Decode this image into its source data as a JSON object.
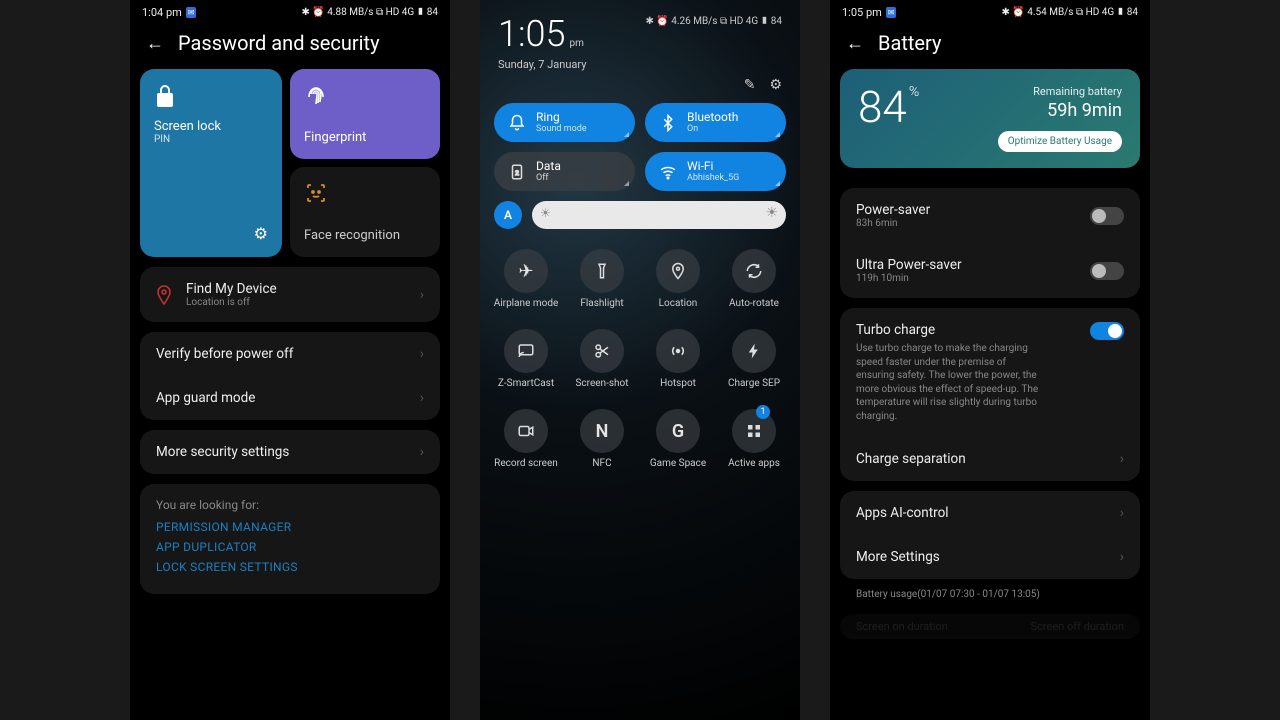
{
  "s1": {
    "status": {
      "time": "1:04 pm",
      "right": "✱ ⏰ 4.88 MB/s ⧉ HD 4G ▮ 84"
    },
    "title": "Password and security",
    "screenlock": {
      "label": "Screen lock",
      "sub": "PIN"
    },
    "fingerprint": "Fingerprint",
    "face": "Face recognition",
    "find": {
      "label": "Find My Device",
      "sub": "Location is off"
    },
    "verify": "Verify before power off",
    "appguard": "App guard mode",
    "more": "More security settings",
    "suggest": {
      "hint": "You are looking for:",
      "a": "PERMISSION MANAGER",
      "b": "APP DUPLICATOR",
      "c": "LOCK SCREEN SETTINGS"
    }
  },
  "s2": {
    "time": "1:05",
    "ampm": "pm",
    "date": "Sunday, 7 January",
    "status_right": "✱ ⏰ 4.26 MB/s ⧉ HD 4G ▮ 84",
    "pills": {
      "ring": {
        "t": "Ring",
        "s": "Sound mode"
      },
      "bt": {
        "t": "Bluetooth",
        "s": "On"
      },
      "data": {
        "t": "Data",
        "s": "Off"
      },
      "wifi": {
        "t": "Wi-Fi",
        "s": "Abhishek_5G"
      }
    },
    "grid": [
      "Airplane mode",
      "Flashlight",
      "Location",
      "Auto-rotate",
      "Z-SmartCast",
      "Screen-shot",
      "Hotspot",
      "Charge SEP",
      "Record screen",
      "NFC",
      "Game Space",
      "Active apps"
    ],
    "active_badge": "1"
  },
  "s3": {
    "status": {
      "time": "1:05 pm",
      "right": "✱ ⏰ 4.54 MB/s ⧉ HD 4G ▮ 84"
    },
    "title": "Battery",
    "pct": "84",
    "remain_lbl": "Remaining battery",
    "remain": "59h 9min",
    "opt": "Optimize Battery Usage",
    "ps": {
      "t": "Power-saver",
      "s": "83h 6min"
    },
    "ups": {
      "t": "Ultra Power-saver",
      "s": "119h 10min"
    },
    "tc": {
      "t": "Turbo charge",
      "d": "Use turbo charge to make the charging speed faster under the premise of ensuring safety. The lower the power, the more obvious the effect of speed-up. The temperature will rise slightly during turbo charging."
    },
    "cs": "Charge separation",
    "ai": "Apps AI-control",
    "ms": "More Settings",
    "usage": "Battery usage(01/07 07:30 - 01/07 13:05)",
    "son": "Screen on duration",
    "sof": "Screen off duration"
  }
}
